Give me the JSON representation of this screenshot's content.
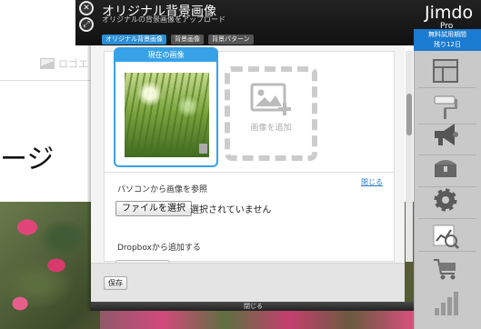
{
  "header": {
    "title": "オリジナル背景画像",
    "subtitle": "オリジナルの背景画像をアップロード",
    "tabs": [
      {
        "label": "オリジナル背景画像",
        "active": true
      },
      {
        "label": "背景画像",
        "active": false
      },
      {
        "label": "背景パターン",
        "active": false
      }
    ],
    "brand": "Jimdo",
    "brand_sub": "Pro"
  },
  "trial": {
    "line1": "無料試用期間",
    "line2": "残り12日"
  },
  "site": {
    "logo_text": "ロゴエ",
    "heading_fragment": "ージ"
  },
  "panel": {
    "current_label": "現在の画像",
    "add_label": "画像を追加",
    "upload_heading": "パソコンから画像を参照",
    "close_link": "閉じる",
    "file_button": "ファイルを選択",
    "file_status": "選択されていません",
    "dropbox_heading": "Dropboxから追加する",
    "save_button": "保存"
  },
  "closebar": {
    "label": "閉じる"
  },
  "sidebar": {
    "items": [
      {
        "icon": "layout-icon"
      },
      {
        "icon": "paint-roller-icon"
      },
      {
        "icon": "megaphone-icon"
      },
      {
        "icon": "treasure-chest-icon"
      },
      {
        "icon": "settings-gear-icon"
      },
      {
        "icon": "statistics-icon"
      },
      {
        "icon": "shopping-cart-icon"
      },
      {
        "icon": "bar-chart-icon"
      }
    ]
  },
  "colors": {
    "accent": "#2b8fd6",
    "trial_bg": "#1a7bd0",
    "topbar": "#1a1a1a"
  }
}
